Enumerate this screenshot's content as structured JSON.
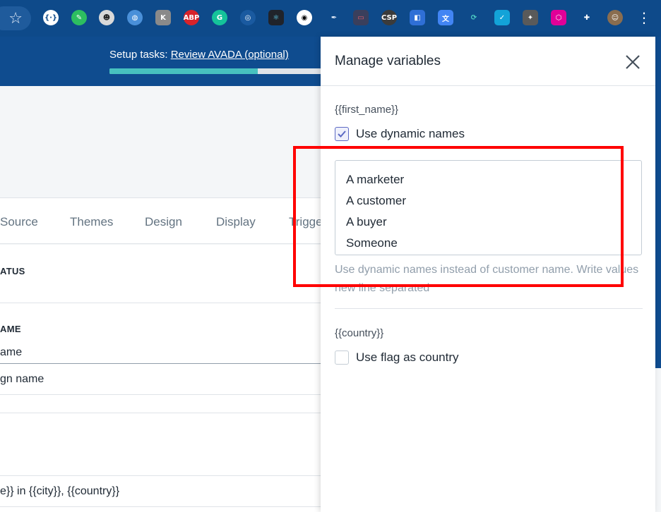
{
  "browser": {
    "bookmark_glyph": "☆",
    "extensions": [
      {
        "name": "json-viewer-icon",
        "glyph": "{·}",
        "bg": "#ffffff",
        "fg": "#0e4a8a",
        "round": true
      },
      {
        "name": "evernote-icon",
        "glyph": "✎",
        "bg": "#2dbe60",
        "fg": "#ffffff",
        "round": true
      },
      {
        "name": "ninja-icon",
        "glyph": "☻",
        "bg": "#d9d9d9",
        "fg": "#222222",
        "round": true
      },
      {
        "name": "globe-icon",
        "glyph": "◍",
        "bg": "#4a90d9",
        "fg": "#ffffff",
        "round": true
      },
      {
        "name": "k-icon",
        "glyph": "K",
        "bg": "#8a8a8a",
        "fg": "#ffffff",
        "round": false
      },
      {
        "name": "adblock-icon",
        "glyph": "ABP",
        "bg": "#d8232a",
        "fg": "#ffffff",
        "round": true
      },
      {
        "name": "grammarly-icon",
        "glyph": "G",
        "bg": "#15c39a",
        "fg": "#ffffff",
        "round": true
      },
      {
        "name": "target-icon",
        "glyph": "◎",
        "bg": "#1a5aa0",
        "fg": "#ffffff",
        "round": true
      },
      {
        "name": "react-devtools-icon",
        "glyph": "⚛",
        "bg": "#20232a",
        "fg": "#61dafb",
        "round": false
      },
      {
        "name": "eye-icon",
        "glyph": "◉",
        "bg": "#ffffff",
        "fg": "#000000",
        "round": true
      },
      {
        "name": "eyedropper-icon",
        "glyph": "✒",
        "bg": "#0e4a8a",
        "fg": "#e6eefa",
        "round": false
      },
      {
        "name": "window-icon",
        "glyph": "▭",
        "bg": "#3a3f5c",
        "fg": "#e35d6a",
        "round": false
      },
      {
        "name": "csp-icon",
        "glyph": "CSP",
        "bg": "#3b3b3b",
        "fg": "#ffffff",
        "round": true
      },
      {
        "name": "sidebar-icon",
        "glyph": "◧",
        "bg": "#2f6fd6",
        "fg": "#ffffff",
        "round": false
      },
      {
        "name": "translate-icon",
        "glyph": "文",
        "bg": "#4285f4",
        "fg": "#ffffff",
        "round": false
      },
      {
        "name": "sync-icon",
        "glyph": "⟳",
        "bg": "#0e4a8a",
        "fg": "#4fd1c5",
        "round": true
      },
      {
        "name": "checkmark-ext-icon",
        "glyph": "✓",
        "bg": "#13a3d8",
        "fg": "#ffffff",
        "round": false
      },
      {
        "name": "lightbulb-icon",
        "glyph": "✦",
        "bg": "#5a5a5a",
        "fg": "#ffffff",
        "round": false
      },
      {
        "name": "graphql-icon",
        "glyph": "⬡",
        "bg": "#e10098",
        "fg": "#ffffff",
        "round": false
      },
      {
        "name": "extensions-puzzle-icon",
        "glyph": "✚",
        "bg": "#0e4a8a",
        "fg": "#ffffff",
        "round": false
      },
      {
        "name": "profile-avatar-icon",
        "glyph": "☺",
        "bg": "#8a6d4f",
        "fg": "#ffffff",
        "round": true
      }
    ],
    "menu_glyph": "⋮"
  },
  "header": {
    "setup_prefix": "Setup tasks: ",
    "setup_link": "Review AVADA (optional)",
    "progress": 0.7,
    "progress_color": "#47c1bf"
  },
  "tabs": [
    "Source",
    "Themes",
    "Design",
    "Display",
    "Trigge"
  ],
  "card": {
    "status_label": "ATUS",
    "name_label": "AME",
    "name_value": "ame",
    "campaign_name_value": "gn name",
    "message_value": "e}} in {{city}}, {{country}}"
  },
  "panel": {
    "title": "Manage variables",
    "first_name": {
      "label": "{{first_name}}",
      "checkbox_label": "Use dynamic names",
      "checked": true,
      "values": [
        "A marketer",
        "A customer",
        "A buyer",
        "Someone"
      ],
      "help": "Use dynamic names instead of customer name. Write values new line separated"
    },
    "country": {
      "label": "{{country}}",
      "checkbox_label": "Use flag as country",
      "checked": false
    }
  },
  "colors": {
    "brand": "#0f4c8f",
    "accent": "#5c6ac4",
    "highlight": "#ff0000"
  }
}
